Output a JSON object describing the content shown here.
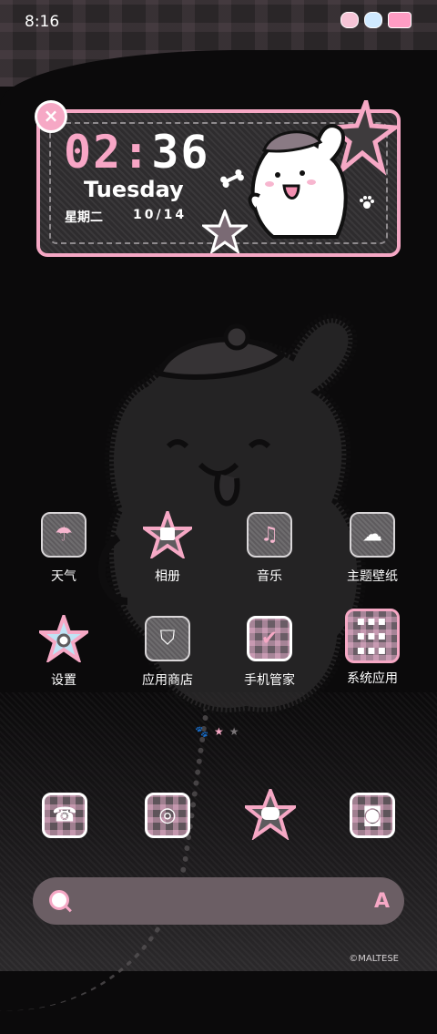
{
  "status_bar": {
    "time": "8:16",
    "icons": [
      "dog-face-icon",
      "bear-face-icon",
      "bunny-badge-icon"
    ]
  },
  "clock_widget": {
    "hours": "02",
    "separator": ":",
    "minutes": "36",
    "weekday_en": "Tuesday",
    "weekday_cn": "星期二",
    "date": "10/14",
    "close_glyph": "×",
    "accent_color": "#f6a8c5"
  },
  "apps": [
    {
      "label": "天气",
      "icon": "umbrella-icon"
    },
    {
      "label": "相册",
      "icon": "photo-icon"
    },
    {
      "label": "音乐",
      "icon": "music-note-icon"
    },
    {
      "label": "主题壁纸",
      "icon": "ice-cream-icon"
    },
    {
      "label": "设置",
      "icon": "gear-icon"
    },
    {
      "label": "应用商店",
      "icon": "shopping-bag-icon"
    },
    {
      "label": "手机管家",
      "icon": "shield-icon"
    },
    {
      "label": "系统应用",
      "icon": "folder-icon"
    }
  ],
  "page_indicator": {
    "pages": 3,
    "current": 2
  },
  "dock": [
    {
      "icon": "phone-icon"
    },
    {
      "icon": "compass-icon"
    },
    {
      "icon": "chat-icon"
    },
    {
      "icon": "camera-icon"
    }
  ],
  "search_bar": {
    "search_icon": "search-icon",
    "assistant_icon": "assistant-icon",
    "assistant_glyph": "A"
  },
  "credit": "©MALTESE"
}
